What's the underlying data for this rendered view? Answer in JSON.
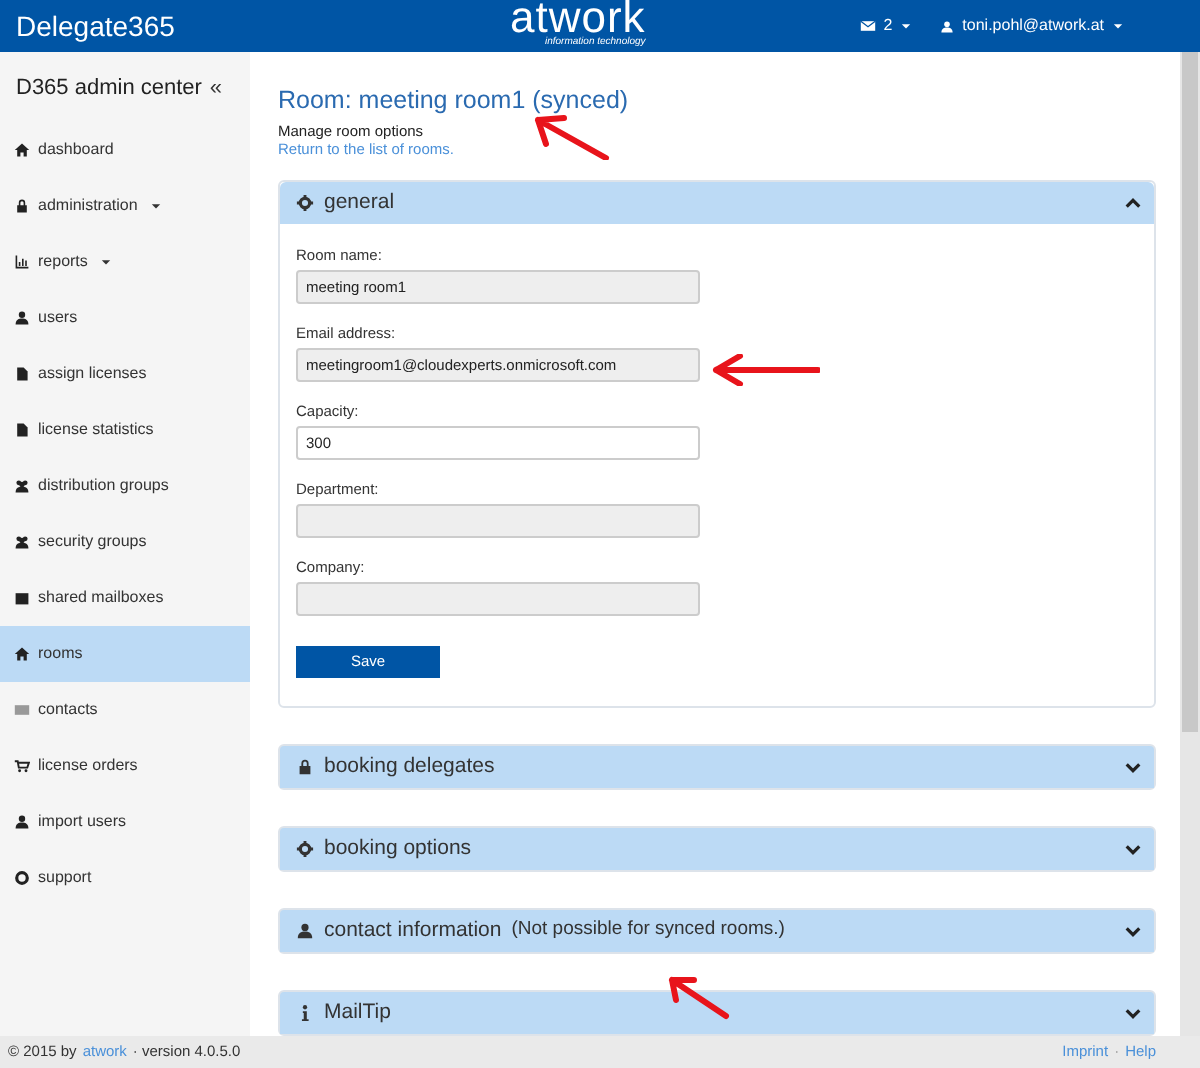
{
  "header": {
    "brand": "Delegate365",
    "logo": {
      "name": "atwork",
      "tagline": "information technology"
    },
    "messages": {
      "count": "2"
    },
    "user": {
      "email": "toni.pohl@atwork.at"
    }
  },
  "sidebar": {
    "title": "D365 admin center",
    "collapse": "«",
    "items": [
      {
        "label": "dashboard",
        "kind": "home",
        "dropdown": false,
        "selected": false
      },
      {
        "label": "administration",
        "kind": "lock",
        "dropdown": true,
        "selected": false
      },
      {
        "label": "reports",
        "kind": "chart",
        "dropdown": true,
        "selected": false
      },
      {
        "label": "users",
        "kind": "user",
        "dropdown": false,
        "selected": false
      },
      {
        "label": "assign licenses",
        "kind": "file",
        "dropdown": false,
        "selected": false
      },
      {
        "label": "license statistics",
        "kind": "file",
        "dropdown": false,
        "selected": false
      },
      {
        "label": "distribution groups",
        "kind": "users",
        "dropdown": false,
        "selected": false
      },
      {
        "label": "security groups",
        "kind": "users",
        "dropdown": false,
        "selected": false
      },
      {
        "label": "shared mailboxes",
        "kind": "inbox",
        "dropdown": false,
        "selected": false
      },
      {
        "label": "rooms",
        "kind": "home",
        "dropdown": false,
        "selected": true
      },
      {
        "label": "contacts",
        "kind": "card",
        "dropdown": false,
        "selected": false
      },
      {
        "label": "license orders",
        "kind": "cart",
        "dropdown": false,
        "selected": false
      },
      {
        "label": "import users",
        "kind": "user",
        "dropdown": false,
        "selected": false
      },
      {
        "label": "support",
        "kind": "lifebuoy",
        "dropdown": false,
        "selected": false
      }
    ]
  },
  "page": {
    "title": "Room: meeting room1 (synced)",
    "subtitle": "Manage room options",
    "back_link": "Return to the list of rooms."
  },
  "sections": [
    {
      "title": "general",
      "kind": "gear",
      "expanded": true,
      "fields": [
        {
          "label": "Room name:",
          "value": "meeting room1",
          "disabled": true
        },
        {
          "label": "Email address:",
          "value": "meetingroom1@cloudexperts.onmicrosoft.com",
          "disabled": true
        },
        {
          "label": "Capacity:",
          "value": "300",
          "disabled": false
        },
        {
          "label": "Department:",
          "disabled": true
        },
        {
          "label": "Company:",
          "disabled": true
        }
      ],
      "button": "Save"
    },
    {
      "title": "booking delegates",
      "kind": "lock",
      "expanded": false
    },
    {
      "title": "booking options",
      "kind": "gear",
      "expanded": false
    },
    {
      "title": "contact information",
      "note": "(Not possible for synced rooms.)",
      "kind": "user",
      "expanded": false
    },
    {
      "title": "MailTip",
      "kind": "info",
      "expanded": false
    }
  ],
  "annotations": [
    {
      "kind": "arrow"
    },
    {
      "kind": "arrow"
    },
    {
      "kind": "arrow"
    }
  ],
  "footer": {
    "copyright": "© 2015 by",
    "company_link": "atwork",
    "version": "· version 4.0.5.0",
    "links": [
      "Imprint",
      "Help"
    ],
    "link_separator": "·"
  }
}
